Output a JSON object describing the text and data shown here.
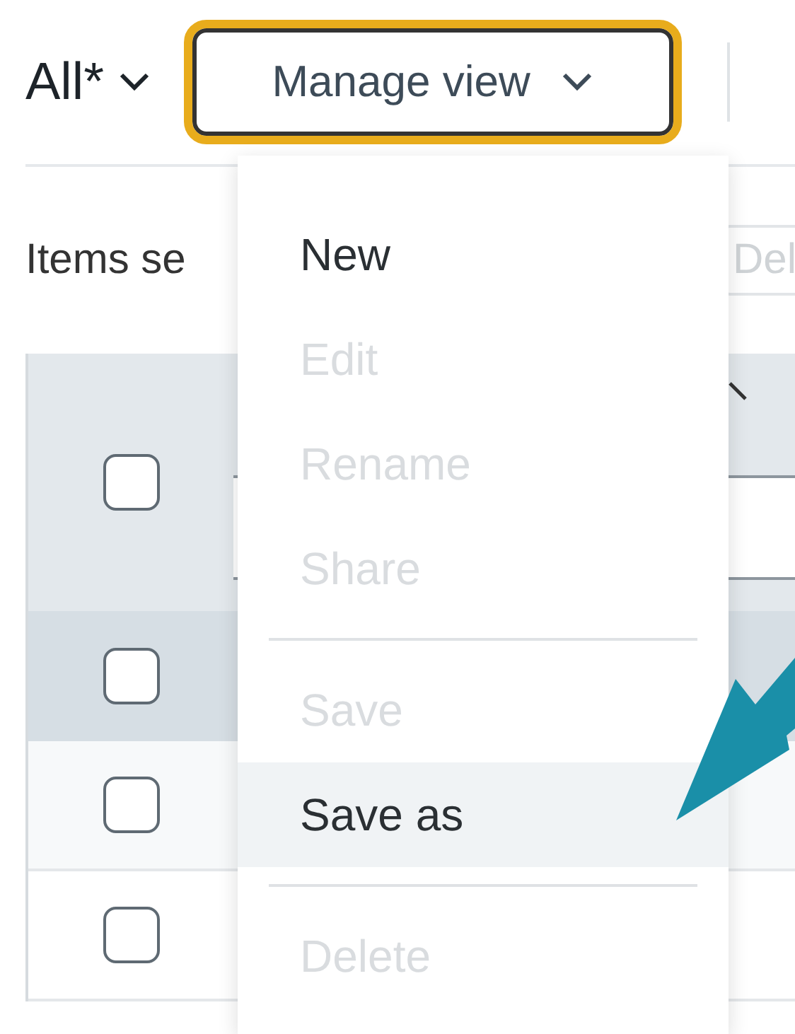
{
  "toolbar": {
    "view": "All*",
    "manage_button": "Manage view",
    "manage_focused": true
  },
  "selection": {
    "label": "Items se",
    "delete_button": "Del",
    "delete_disabled": true
  },
  "table": {
    "header_checked": false,
    "rows": [
      {
        "checked": false,
        "hovered": true
      },
      {
        "checked": false,
        "hovered": false
      },
      {
        "checked": false,
        "hovered": false
      }
    ]
  },
  "menu": {
    "groups": [
      [
        {
          "label": "New",
          "disabled": false,
          "highlighted": false
        },
        {
          "label": "Edit",
          "disabled": true,
          "highlighted": false
        },
        {
          "label": "Rename",
          "disabled": true,
          "highlighted": false
        },
        {
          "label": "Share",
          "disabled": true,
          "highlighted": false
        }
      ],
      [
        {
          "label": "Save",
          "disabled": true,
          "highlighted": false
        },
        {
          "label": "Save as",
          "disabled": false,
          "highlighted": true
        }
      ],
      [
        {
          "label": "Delete",
          "disabled": true,
          "highlighted": false
        }
      ]
    ]
  }
}
